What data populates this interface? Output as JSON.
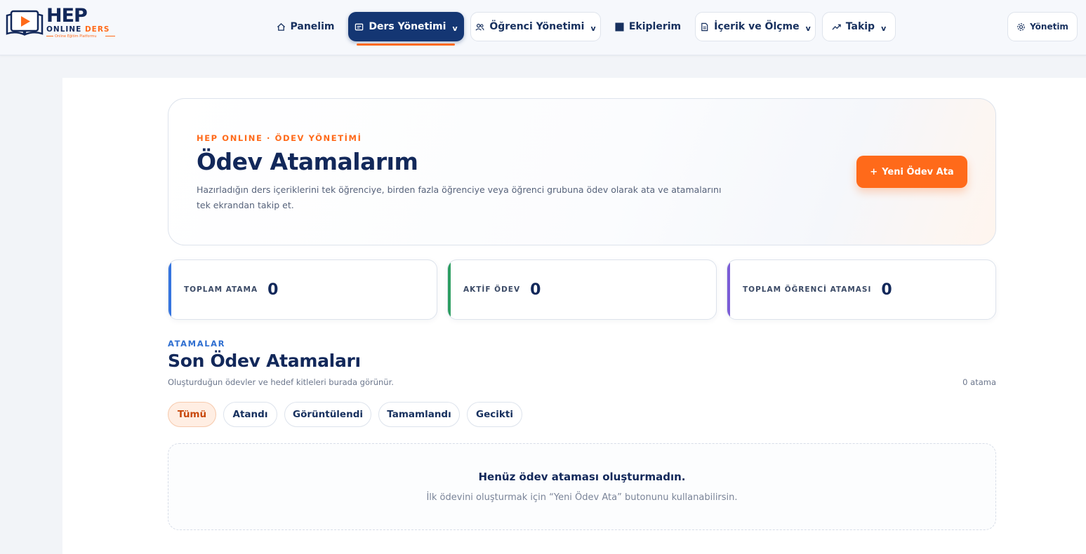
{
  "brand": {
    "name": "HEP",
    "sub_online": "ONLINE",
    "sub_ders": "DERS",
    "tagline": "Online Eğitim Platformu"
  },
  "nav": {
    "items": [
      {
        "label": "Panelim",
        "icon": "home-icon"
      },
      {
        "label": "Ders Yönetimi",
        "icon": "book-icon"
      },
      {
        "label": "Öğrenci Yönetimi",
        "icon": "users-icon"
      },
      {
        "label": "Ekiplerim",
        "icon": "square-icon"
      },
      {
        "label": "İçerik ve Ölçme",
        "icon": "document-icon"
      },
      {
        "label": "Takip",
        "icon": "trend-icon"
      }
    ],
    "chevron": "v",
    "admin_label": "Yönetim"
  },
  "hero": {
    "kicker": "HEP ONLINE · ÖDEV YÖNETİMİ",
    "title": "Ödev Atamalarım",
    "description": "Hazırladığın ders içeriklerini tek öğrenciye, birden fazla öğrenciye veya öğrenci grubuna ödev olarak ata ve atamalarını tek ekrandan takip et.",
    "cta_label": "Yeni Ödev Ata",
    "cta_plus": "+"
  },
  "stats": [
    {
      "label": "TOPLAM ATAMA",
      "value": "0",
      "color": "#3574df"
    },
    {
      "label": "AKTİF ÖDEV",
      "value": "0",
      "color": "#2e9e62"
    },
    {
      "label": "TOPLAM ÖĞRENCİ ATAMASI",
      "value": "0",
      "color": "#7b5cd6"
    }
  ],
  "section": {
    "kicker": "ATAMALAR",
    "title": "Son Ödev Atamaları",
    "description": "Oluşturduğun ödevler ve hedef kitleleri burada görünür.",
    "count": "0 atama"
  },
  "filters": [
    {
      "label": "Tümü"
    },
    {
      "label": "Atandı"
    },
    {
      "label": "Görüntülendi"
    },
    {
      "label": "Tamamlandı"
    },
    {
      "label": "Gecikti"
    }
  ],
  "empty": {
    "title": "Henüz ödev ataması oluşturmadın.",
    "message": "İlk ödevini oluşturmak için “Yeni Ödev Ata” butonunu kullanabilirsin."
  },
  "colors": {
    "primary": "#143673",
    "accent": "#ff6a1a"
  }
}
